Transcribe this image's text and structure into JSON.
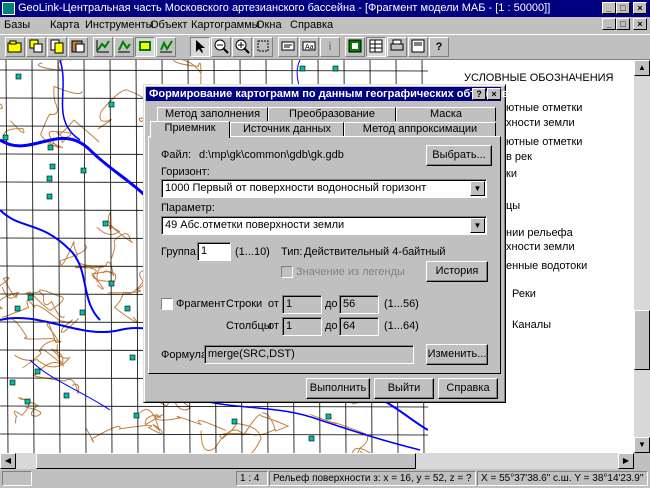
{
  "window": {
    "title": "GeoLink-Центральная часть Московского артезианского бассейна - [Фрагмент модели МАБ - [1 : 50000]]"
  },
  "menu": [
    "Базы",
    "Карта",
    "Инструменты",
    "Объект",
    "Картограммы",
    "Окна",
    "Справка"
  ],
  "toolbar": {
    "buttons": [
      "open-icon",
      "layers-icon",
      "copy-icon",
      "paste-icon",
      "chart-icon",
      "chart2-icon",
      "chart3-icon",
      "chart4-icon",
      "pointer-icon",
      "zoom-out-icon",
      "zoom-in-icon",
      "zoom-rect-icon",
      "text-icon",
      "scale-icon",
      "info-icon",
      "grid-icon",
      "table-icon",
      "print-icon",
      "print-preview-icon",
      "help-icon"
    ],
    "help_label": "?",
    "info_label": "i"
  },
  "legend": {
    "title": "УСЛОВНЫЕ ОБОЗНАЧЕНИЯ",
    "lines": [
      "ютные  отметки",
      "хности     земли",
      "ютные  отметки",
      "в   рек",
      "ки",
      "цы",
      "нии   рельефа",
      "хности   земли",
      "енные водотоки",
      "Реки",
      "Каналы"
    ]
  },
  "dialog": {
    "title": "Формирование картограмм по данным географических объектов",
    "help_btn": "?",
    "close_btn": "×",
    "tabs_back": [
      "Метод заполнения",
      "Преобразование",
      "Маска"
    ],
    "tabs_front": [
      "Приемник",
      "Источник данных",
      "Метод аппроксимации"
    ],
    "file_label": "Файл:",
    "file_path": "d:\\mp\\gk\\common\\gdb\\gk.gdb",
    "choose_btn": "Выбрать...",
    "horizon_label": "Горизонт:",
    "horizon_value": "1000 Первый от поверхности водоносный горизонт",
    "param_label": "Параметр:",
    "param_value": "49 Абс.отметки поверхности земли",
    "group_label": "Группа:",
    "group_value": "1",
    "group_range": "(1...10)",
    "type_label": "Тип:",
    "type_value": "Действительный 4-байтный",
    "legend_value_label": "Значение из легенды",
    "history_btn": "История",
    "fragment_label": "Фрагмент",
    "rows_label": "Строки",
    "from_label": "от",
    "to_label": "до",
    "rows_from": "1",
    "rows_to": "56",
    "rows_range": "(1...56)",
    "cols_label": "Столбцы",
    "cols_from": "1",
    "cols_to": "64",
    "cols_range": "(1...64)",
    "formula_label": "Формула:",
    "formula_value": "merge(SRC,DST)",
    "change_btn": "Изменить...",
    "run_btn": "Выполнить",
    "exit_btn": "Выйти",
    "help_btn2": "Справка"
  },
  "status": {
    "scale": "1 : 4",
    "info": "Рельеф поверхности  з: x = 16, y = 52, z = ?",
    "coords": "X = 55°37'38.6\" с.ш.  Y = 38°14'23.9\" в.д."
  },
  "colors": {
    "titlebar": "#000080",
    "river": "#0000ff",
    "contour": "#c08040",
    "grid": "#000000",
    "marker": "#00c0a0"
  }
}
